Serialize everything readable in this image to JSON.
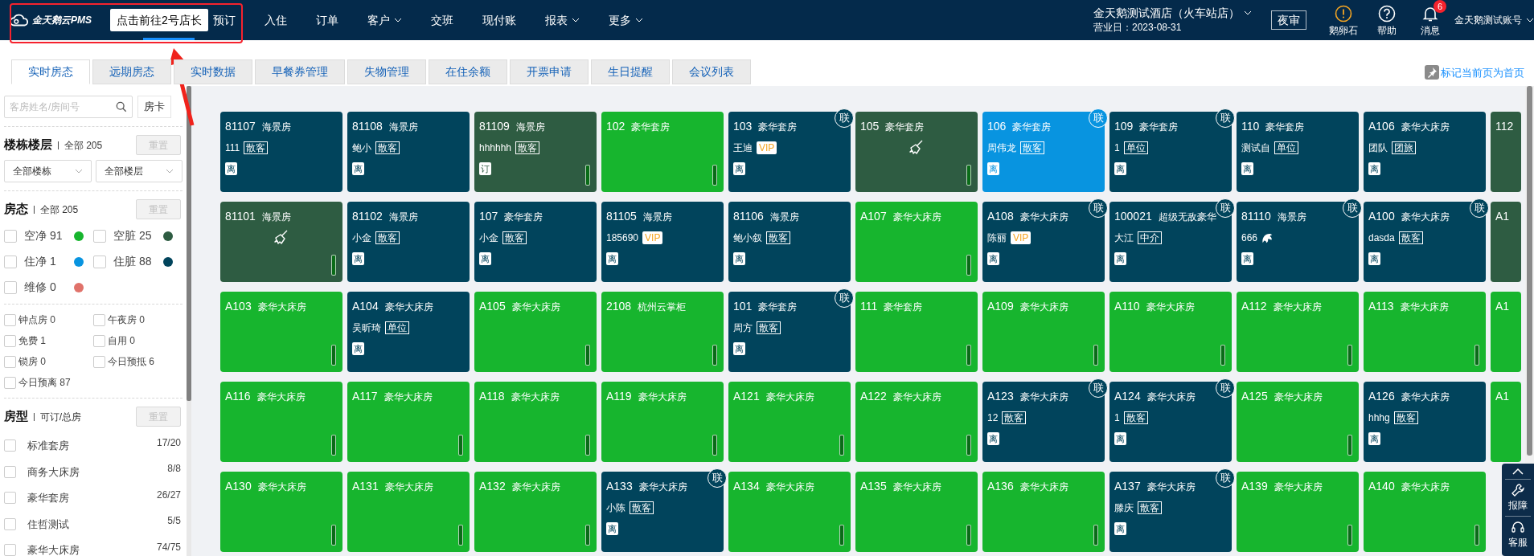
{
  "header": {
    "logo_text": "金天鹅云PMS",
    "tooltip": {
      "text": "点击前往2号店长",
      "covers_selected_tab": true
    },
    "nav": [
      {
        "label": "预订",
        "dropdown": false,
        "selected": false
      },
      {
        "label": "入住",
        "dropdown": false,
        "selected": false
      },
      {
        "label": "订单",
        "dropdown": false,
        "selected": false
      },
      {
        "label": "客户",
        "dropdown": true,
        "selected": false
      },
      {
        "label": "交班",
        "dropdown": false,
        "selected": false
      },
      {
        "label": "现付账",
        "dropdown": false,
        "selected": false
      },
      {
        "label": "报表",
        "dropdown": true,
        "selected": false
      },
      {
        "label": "更多",
        "dropdown": true,
        "selected": false
      }
    ],
    "store": "金天鹅测试酒店（火车站店）",
    "business_date": "营业日：2023-08-31",
    "night_audit": "夜审",
    "icon_buttons": [
      {
        "label": "鹅卵石",
        "kind": "alert"
      },
      {
        "label": "帮助",
        "kind": "help"
      },
      {
        "label": "消息",
        "kind": "bell",
        "badge": "6"
      }
    ],
    "account": "金天鹅测试账号"
  },
  "annotations": {
    "highlight_box": true,
    "arrow": true
  },
  "tabs": [
    {
      "label": "实时房态",
      "selected": true
    },
    {
      "label": "远期房态",
      "selected": false
    },
    {
      "label": "实时数据",
      "selected": false
    },
    {
      "label": "早餐券管理",
      "selected": false
    },
    {
      "label": "失物管理",
      "selected": false
    },
    {
      "label": "在住余额",
      "selected": false
    },
    {
      "label": "开票申请",
      "selected": false
    },
    {
      "label": "生日提醒",
      "selected": false
    },
    {
      "label": "会议列表",
      "selected": false
    }
  ],
  "pin_link": "标记当前页为首页",
  "sidebar": {
    "search": {
      "placeholder": "客房姓名/房间号"
    },
    "room_card_button": "房卡",
    "building_floor": {
      "title": "楼栋楼层",
      "divider": "|",
      "summary": "全部 205",
      "reset": {
        "label": "重置",
        "disabled": true
      },
      "selects": [
        "全部楼栋",
        "全部楼层"
      ]
    },
    "room_status": {
      "title": "房态",
      "divider": "|",
      "summary": "全部 205",
      "reset": {
        "label": "重置",
        "disabled": true
      },
      "items": [
        {
          "label": "空净 91",
          "color": "#17b52e",
          "checked": false
        },
        {
          "label": "空脏 25",
          "color": "#2e5c42",
          "checked": false
        },
        {
          "label": "住净 1",
          "color": "#0894e0",
          "checked": false
        },
        {
          "label": "住脏 88",
          "color": "#01445c",
          "checked": false
        },
        {
          "label": "维修 0",
          "color": "#e0726a",
          "checked": false
        }
      ],
      "flags": [
        {
          "label": "钟点房 0",
          "checked": false
        },
        {
          "label": "午夜房 0",
          "checked": false
        },
        {
          "label": "免费 1",
          "checked": false
        },
        {
          "label": "自用 0",
          "checked": false
        },
        {
          "label": "锁房 0",
          "checked": false
        },
        {
          "label": "今日预抵 6",
          "checked": false
        },
        {
          "label": "今日预离 87",
          "checked": false
        }
      ]
    },
    "room_types": {
      "title": "房型",
      "divider": "|",
      "summary": "可订/总房",
      "reset": {
        "label": "重置",
        "disabled": true
      },
      "items": [
        {
          "name": "标准套房",
          "count": "17/20",
          "checked": false
        },
        {
          "name": "商务大床房",
          "count": "8/8",
          "checked": false
        },
        {
          "name": "豪华套房",
          "count": "26/27",
          "checked": false
        },
        {
          "name": "住哲测试",
          "count": "5/5",
          "checked": false
        },
        {
          "name": "豪华大床房",
          "count": "74/75",
          "checked": false
        }
      ]
    }
  },
  "rooms": [
    {
      "number": "81107",
      "type": "海景房",
      "color": "#01445c",
      "guest": "111",
      "tag": {
        "text": "散客",
        "kind": "plain"
      },
      "mark": "离",
      "indicator": false
    },
    {
      "number": "81108",
      "type": "海景房",
      "color": "#01445c",
      "guest": "鲍小",
      "tag": {
        "text": "散客",
        "kind": "plain"
      },
      "mark": "离",
      "indicator": false
    },
    {
      "number": "81109",
      "type": "海景房",
      "color": "#2e5c42",
      "guest": "hhhhhh",
      "tag": {
        "text": "散客",
        "kind": "plain"
      },
      "mark": "订",
      "indicator": true
    },
    {
      "number": "102",
      "type": "豪华套房",
      "color": "#17b52e",
      "indicator": true
    },
    {
      "number": "103",
      "type": "豪华套房",
      "color": "#01445c",
      "guest": "王迪",
      "tag": {
        "text": "VIP",
        "kind": "vip"
      },
      "mark": "离",
      "link_badge": "联",
      "indicator": false
    },
    {
      "number": "105",
      "type": "豪华套房",
      "color": "#2e5c42",
      "kind": "broom",
      "indicator": true
    },
    {
      "number": "106",
      "type": "豪华套房",
      "color": "#0894e0",
      "guest": "周伟龙",
      "tag": {
        "text": "散客",
        "kind": "plain"
      },
      "mark": "离",
      "link_badge": "联",
      "indicator": false
    },
    {
      "number": "109",
      "type": "豪华套房",
      "color": "#01445c",
      "guest": "1",
      "tag": {
        "text": "单位",
        "kind": "plain"
      },
      "mark": "离",
      "link_badge": "联",
      "indicator": false
    },
    {
      "number": "110",
      "type": "豪华套房",
      "color": "#01445c",
      "guest": "测试自",
      "tag": {
        "text": "单位",
        "kind": "plain"
      },
      "mark": "离",
      "indicator": false
    },
    {
      "number": "A106",
      "type": "豪华大床房",
      "color": "#01445c",
      "guest": "团队",
      "tag": {
        "text": "团旅",
        "kind": "plain"
      },
      "mark": "离",
      "indicator": false
    },
    {
      "number": "112",
      "color": "#2e5c42",
      "indicator": false
    },
    {
      "number": "81101",
      "type": "海景房",
      "color": "#2e5c42",
      "kind": "broom",
      "indicator": true
    },
    {
      "number": "81102",
      "type": "海景房",
      "color": "#01445c",
      "guest": "小金",
      "tag": {
        "text": "散客",
        "kind": "plain"
      },
      "mark": "离",
      "indicator": false
    },
    {
      "number": "107",
      "type": "豪华套房",
      "color": "#01445c",
      "guest": "小金",
      "tag": {
        "text": "散客",
        "kind": "plain"
      },
      "mark": "离",
      "indicator": false
    },
    {
      "number": "81105",
      "type": "海景房",
      "color": "#01445c",
      "guest": "185690",
      "tag": {
        "text": "VIP",
        "kind": "vip"
      },
      "mark": "离",
      "indicator": false
    },
    {
      "number": "81106",
      "type": "海景房",
      "color": "#01445c",
      "guest": "鲍小叙",
      "tag": {
        "text": "散客",
        "kind": "plain"
      },
      "mark": "离",
      "indicator": false
    },
    {
      "number": "A107",
      "type": "豪华大床房",
      "color": "#17b52e",
      "indicator": true
    },
    {
      "number": "A108",
      "type": "豪华大床房",
      "color": "#01445c",
      "guest": "陈丽",
      "tag": {
        "text": "VIP",
        "kind": "vip"
      },
      "mark": "离",
      "link_badge": "联",
      "indicator": false
    },
    {
      "number": "100021",
      "type": "超级无敌豪华",
      "color": "#01445c",
      "guest": "大江",
      "tag": {
        "text": "中介",
        "kind": "plain"
      },
      "mark": "离",
      "link_badge": "联",
      "indicator": false
    },
    {
      "number": "81110",
      "type": "海景房",
      "color": "#01445c",
      "guest": "666",
      "kind": "dolphin",
      "mark": "离",
      "link_badge": "联",
      "indicator": false
    },
    {
      "number": "A100",
      "type": "豪华大床房",
      "color": "#01445c",
      "guest": "dasda",
      "tag": {
        "text": "散客",
        "kind": "plain"
      },
      "mark": "离",
      "link_badge": "联",
      "indicator": false
    },
    {
      "number": "A1",
      "color": "#2e5c42",
      "indicator": false
    },
    {
      "number": "A103",
      "type": "豪华大床房",
      "color": "#17b52e",
      "indicator": true
    },
    {
      "number": "A104",
      "type": "豪华大床房",
      "color": "#01445c",
      "guest": "吴昕琦",
      "tag": {
        "text": "单位",
        "kind": "plain"
      },
      "mark": "离",
      "indicator": false
    },
    {
      "number": "A105",
      "type": "豪华大床房",
      "color": "#17b52e",
      "indicator": true
    },
    {
      "number": "2108",
      "type": "杭州云掌柜",
      "color": "#17b52e",
      "indicator": true
    },
    {
      "number": "101",
      "type": "豪华套房",
      "color": "#01445c",
      "guest": "周方",
      "tag": {
        "text": "散客",
        "kind": "plain"
      },
      "mark": "离",
      "link_badge": "联",
      "indicator": false
    },
    {
      "number": "111",
      "type": "豪华套房",
      "color": "#17b52e",
      "indicator": true
    },
    {
      "number": "A109",
      "type": "豪华大床房",
      "color": "#17b52e",
      "indicator": true
    },
    {
      "number": "A110",
      "type": "豪华大床房",
      "color": "#17b52e",
      "indicator": true
    },
    {
      "number": "A112",
      "type": "豪华大床房",
      "color": "#17b52e",
      "indicator": true
    },
    {
      "number": "A113",
      "type": "豪华大床房",
      "color": "#17b52e",
      "indicator": true
    },
    {
      "number": "A1",
      "color": "#17b52e",
      "indicator": false
    },
    {
      "number": "A116",
      "type": "豪华大床房",
      "color": "#17b52e",
      "indicator": true
    },
    {
      "number": "A117",
      "type": "豪华大床房",
      "color": "#17b52e",
      "indicator": true
    },
    {
      "number": "A118",
      "type": "豪华大床房",
      "color": "#17b52e",
      "indicator": true
    },
    {
      "number": "A119",
      "type": "豪华大床房",
      "color": "#17b52e",
      "indicator": true
    },
    {
      "number": "A121",
      "type": "豪华大床房",
      "color": "#17b52e",
      "indicator": true
    },
    {
      "number": "A122",
      "type": "豪华大床房",
      "color": "#17b52e",
      "indicator": true
    },
    {
      "number": "A123",
      "type": "豪华大床房",
      "color": "#01445c",
      "guest": "12",
      "tag": {
        "text": "散客",
        "kind": "plain"
      },
      "mark": "离",
      "link_badge": "联",
      "indicator": false
    },
    {
      "number": "A124",
      "type": "豪华大床房",
      "color": "#01445c",
      "guest": "1",
      "tag": {
        "text": "散客",
        "kind": "plain"
      },
      "mark": "离",
      "link_badge": "联",
      "indicator": false
    },
    {
      "number": "A125",
      "type": "豪华大床房",
      "color": "#17b52e",
      "indicator": true
    },
    {
      "number": "A126",
      "type": "豪华大床房",
      "color": "#01445c",
      "guest": "hhhg",
      "tag": {
        "text": "散客",
        "kind": "plain"
      },
      "mark": "离",
      "indicator": false
    },
    {
      "number": "A1",
      "color": "#17b52e",
      "indicator": false
    },
    {
      "number": "A130",
      "type": "豪华大床房",
      "color": "#17b52e",
      "indicator": true
    },
    {
      "number": "A131",
      "type": "豪华大床房",
      "color": "#17b52e",
      "indicator": true
    },
    {
      "number": "A132",
      "type": "豪华大床房",
      "color": "#17b52e",
      "indicator": true
    },
    {
      "number": "A133",
      "type": "豪华大床房",
      "color": "#01445c",
      "guest": "小陈",
      "tag": {
        "text": "散客",
        "kind": "plain"
      },
      "mark": "离",
      "link_badge": "联",
      "indicator": false
    },
    {
      "number": "A134",
      "type": "豪华大床房",
      "color": "#17b52e",
      "indicator": true
    },
    {
      "number": "A135",
      "type": "豪华大床房",
      "color": "#17b52e",
      "indicator": true
    },
    {
      "number": "A136",
      "type": "豪华大床房",
      "color": "#17b52e",
      "indicator": true
    },
    {
      "number": "A137",
      "type": "豪华大床房",
      "color": "#01445c",
      "guest": "滕庆",
      "tag": {
        "text": "散客",
        "kind": "plain"
      },
      "mark": "离",
      "link_badge": "联",
      "indicator": false
    },
    {
      "number": "A139",
      "type": "豪华大床房",
      "color": "#17b52e",
      "indicator": true
    },
    {
      "number": "A140",
      "type": "豪华大床房",
      "color": "#17b52e",
      "indicator": true
    }
  ],
  "float_toolbar": [
    {
      "label": "报障",
      "kind": "wrench"
    },
    {
      "label": "客服",
      "kind": "headset"
    }
  ]
}
